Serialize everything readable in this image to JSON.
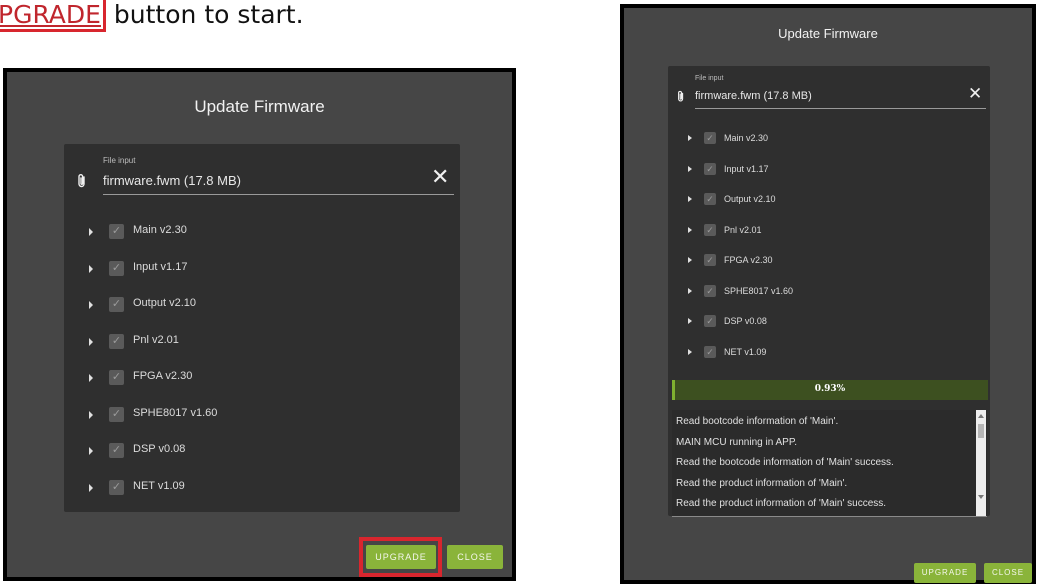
{
  "instruction": {
    "highlight": "PGRADE",
    "rest": " button to start."
  },
  "dialog_idle": {
    "title": "Update Firmware",
    "file_label": "File input",
    "file_value": "firmware.fwm (17.8 MB)",
    "clear_icon": "close-icon",
    "modules": [
      {
        "label": "Main v2.30",
        "checked": true
      },
      {
        "label": "Input v1.17",
        "checked": true
      },
      {
        "label": "Output v2.10",
        "checked": true
      },
      {
        "label": "Pnl v2.01",
        "checked": true
      },
      {
        "label": "FPGA v2.30",
        "checked": true
      },
      {
        "label": "SPHE8017 v1.60",
        "checked": true
      },
      {
        "label": "DSP v0.08",
        "checked": true
      },
      {
        "label": "NET v1.09",
        "checked": true
      }
    ],
    "buttons": {
      "upgrade": "UPGRADE",
      "close": "CLOSE"
    },
    "highlight_color": "#d8262e"
  },
  "dialog_progress": {
    "title": "Update Firmware",
    "file_label": "File input",
    "file_value": "firmware.fwm (17.8 MB)",
    "modules": [
      {
        "label": "Main v2.30",
        "checked": true
      },
      {
        "label": "Input v1.17",
        "checked": true
      },
      {
        "label": "Output v2.10",
        "checked": true
      },
      {
        "label": "Pnl v2.01",
        "checked": true
      },
      {
        "label": "FPGA v2.30",
        "checked": true
      },
      {
        "label": "SPHE8017 v1.60",
        "checked": true
      },
      {
        "label": "DSP v0.08",
        "checked": true
      },
      {
        "label": "NET v1.09",
        "checked": true
      }
    ],
    "progress": {
      "percent_text": "0.93%",
      "fraction": 0.0093
    },
    "log": [
      "Read bootcode information of 'Main'.",
      "MAIN MCU running in APP.",
      "Read the bootcode information of 'Main'  success.",
      "Read the product information of 'Main'.",
      "Read the product information of 'Main'  success."
    ],
    "buttons": {
      "upgrade": "UPGRADE",
      "close": "CLOSE"
    }
  },
  "colors": {
    "panel": "#464646",
    "card": "#2f2f2f",
    "accent": "#8ab43a",
    "progress_fill": "#7fb030"
  }
}
